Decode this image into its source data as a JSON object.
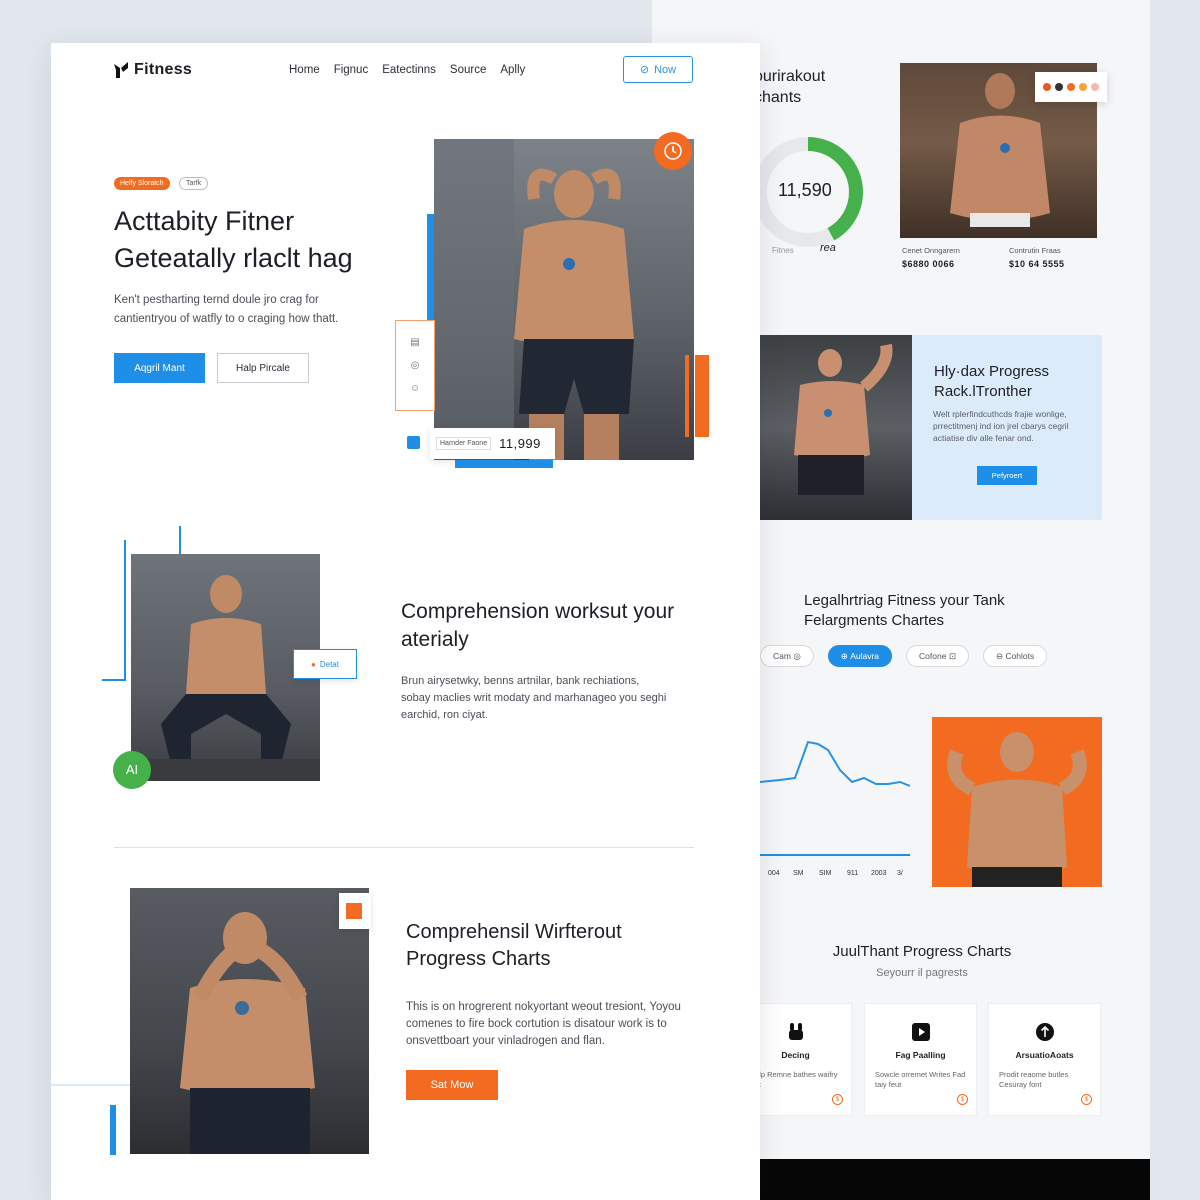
{
  "brand": {
    "name": "Fitness"
  },
  "nav": {
    "items": [
      "Home",
      "Fignuc",
      "Eatectinns",
      "Source",
      "Aplly"
    ],
    "cta": "Now"
  },
  "hero": {
    "tags": [
      "Helfy Sloratch",
      "Tarfk"
    ],
    "title_line1": "Acttabity Fitner",
    "title_line2": "Geteatally rlaclt hag",
    "desc": "Ken't pestharting ternd doule jro crag for cantientryou of watfly to o craging how thatt.",
    "btn_primary": "Aqgril Mant",
    "btn_secondary": "Halp Pircale",
    "stat_label": "Harnder Faone",
    "stat_value": "11,999"
  },
  "section2": {
    "badge": "Detat",
    "ai_badge": "AI",
    "title": "Comprehension worksut your aterialy",
    "desc": "Brun airysetwky, benns artnilar, bank rechiations, sobay maclies writ modaty and marhanageo you seghi earchid, ron ciyat."
  },
  "section3": {
    "title": "Comprehensil Wirfterout Progress Charts",
    "desc": "This is on hrogrerent nokyortant weout tresiont, Yoyou comenes to fire bock cortution is disatour work is to onsvettboart your vinladrogen and flan.",
    "btn": "Sat Mow"
  },
  "back": {
    "title": "ourirakout chants",
    "donut_value": "11,590",
    "donut_progress": 0.42,
    "donut_caption": "Fitnes",
    "donut_mark": "rea",
    "stats": [
      {
        "caption": "Cenet Onngarern",
        "value": "$6880 0066"
      },
      {
        "caption": "Contrutin Fraas",
        "value": "$10 64 5555"
      }
    ],
    "dot_colors": [
      "#e55a1e",
      "#333333",
      "#f26b21",
      "#f6a531",
      "#f4b8b0"
    ],
    "card2": {
      "title": "Hly·dax Progress Rack.lTronther",
      "desc": "Welt rplerfindcuthcds frajie wonlige, prrectitmenj ind ion jrel cbarys cegril actiatise div alle fenar ond.",
      "btn": "Pefyroert"
    },
    "section_title": "Legalhrtriag Fitness your Tank Felargments Chartes",
    "chips": [
      "Cam",
      "Aulavra",
      "Cofone",
      "Cohlots"
    ],
    "chip_active_index": 1,
    "x_ticks": [
      "004",
      "SM",
      "SIM",
      "911",
      "2003",
      "3/"
    ],
    "jt_title": "JuulThant Progress Charts",
    "jt_sub": "Seyourr il pagrests",
    "features": [
      {
        "title": "Decing",
        "desc": "Ealp Remne bathes waifry fort",
        "icon": "bunny-icon"
      },
      {
        "title": "Fag Paalling",
        "desc": "Sowcle orremet Writes Fad taiy feut",
        "icon": "play-icon"
      },
      {
        "title": "ArsuatioAoats",
        "desc": "Prodit reaome butles Cesuray font",
        "icon": "arrow-up-icon"
      }
    ]
  },
  "colors": {
    "accent_blue": "#1f8ee6",
    "accent_orange": "#f26b21",
    "accent_green": "#46b04a"
  }
}
